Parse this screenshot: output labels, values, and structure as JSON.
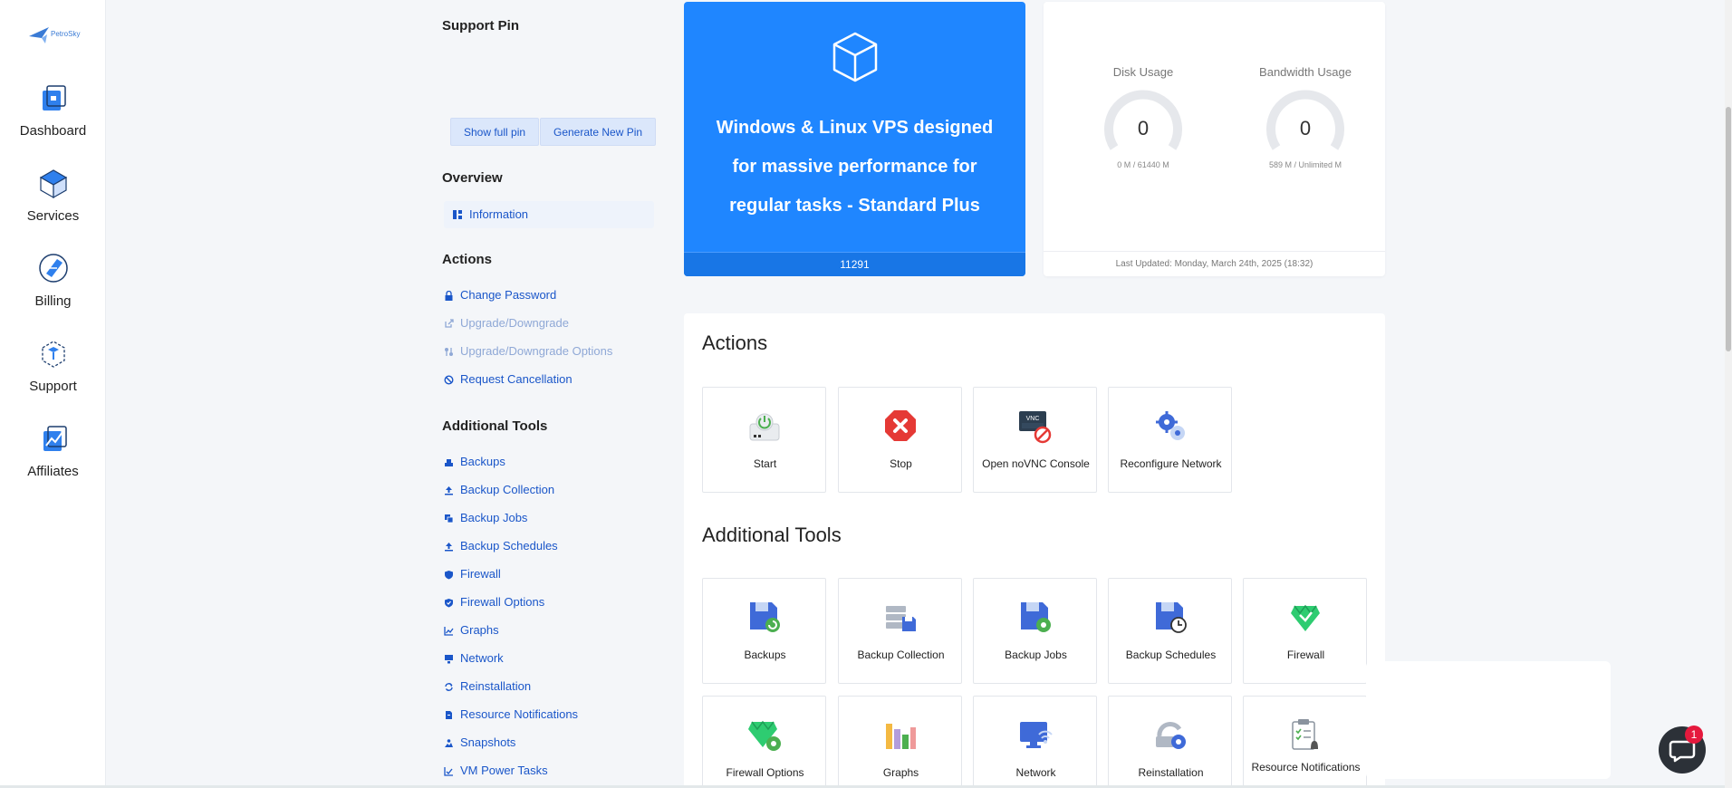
{
  "brand": {
    "logo_text": "PetroSky"
  },
  "nav": {
    "items": [
      {
        "label": "Dashboard"
      },
      {
        "label": "Services"
      },
      {
        "label": "Billing"
      },
      {
        "label": "Support"
      },
      {
        "label": "Affiliates"
      }
    ]
  },
  "support_pin": {
    "title": "Support Pin",
    "show_button": "Show full pin",
    "generate_button": "Generate New Pin"
  },
  "overview": {
    "title": "Overview",
    "items": [
      {
        "label": "Information"
      }
    ]
  },
  "actions_menu": {
    "title": "Actions",
    "items": [
      {
        "label": "Change Password",
        "disabled": false
      },
      {
        "label": "Upgrade/Downgrade",
        "disabled": true
      },
      {
        "label": "Upgrade/Downgrade Options",
        "disabled": true
      },
      {
        "label": "Request Cancellation",
        "disabled": false
      }
    ]
  },
  "tools_menu": {
    "title": "Additional Tools",
    "items": [
      {
        "label": "Backups"
      },
      {
        "label": "Backup Collection"
      },
      {
        "label": "Backup Jobs"
      },
      {
        "label": "Backup Schedules"
      },
      {
        "label": "Firewall"
      },
      {
        "label": "Firewall Options"
      },
      {
        "label": "Graphs"
      },
      {
        "label": "Network"
      },
      {
        "label": "Reinstallation"
      },
      {
        "label": "Resource Notifications"
      },
      {
        "label": "Snapshots"
      },
      {
        "label": "VM Power Tasks"
      }
    ]
  },
  "product": {
    "title": "Windows & Linux VPS designed for massive performance for regular tasks - Standard Plus",
    "id": "11291"
  },
  "usage": {
    "disk": {
      "label": "Disk Usage",
      "value": "0",
      "detail": "0 M / 61440 M"
    },
    "bandwidth": {
      "label": "Bandwidth Usage",
      "value": "0",
      "detail": "589 M / Unlimited M"
    },
    "last_updated": "Last Updated: Monday, March 24th, 2025 (18:32)"
  },
  "actions_panel": {
    "title": "Actions",
    "tiles": [
      {
        "label": "Start"
      },
      {
        "label": "Stop"
      },
      {
        "label": "Open noVNC Console"
      },
      {
        "label": "Reconfigure Network"
      }
    ]
  },
  "tools_panel": {
    "title": "Additional Tools",
    "tiles": [
      {
        "label": "Backups"
      },
      {
        "label": "Backup Collection"
      },
      {
        "label": "Backup Jobs"
      },
      {
        "label": "Backup Schedules"
      },
      {
        "label": "Firewall"
      },
      {
        "label": "Firewall Options"
      },
      {
        "label": "Graphs"
      },
      {
        "label": "Network"
      },
      {
        "label": "Reinstallation"
      },
      {
        "label": "Resource Notifications"
      }
    ]
  },
  "chat": {
    "badge": "1"
  },
  "colors": {
    "primary": "#1f86ff",
    "link": "#1a56c9",
    "danger": "#e5193d"
  }
}
